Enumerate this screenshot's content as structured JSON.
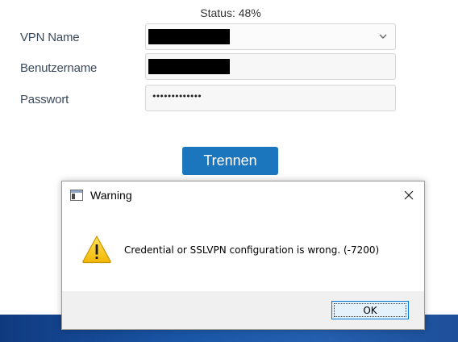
{
  "status": {
    "text": "Status: 48%",
    "progress_percent": 48
  },
  "form": {
    "vpn_name": {
      "label": "VPN Name",
      "value_redacted": true,
      "icon": "chevron-down-icon"
    },
    "username": {
      "label": "Benutzername",
      "value_redacted": true
    },
    "password": {
      "label": "Passwort",
      "masked_value": "•••••••••••••"
    },
    "disconnect_button_label": "Trennen",
    "accent_color": "#1b76bd"
  },
  "dialog": {
    "title": "Warning",
    "message": "Credential or SSLVPN configuration is wrong. (-7200)",
    "ok_label": "OK",
    "icons": {
      "app": "window-app-icon",
      "close": "close-icon",
      "warning": "warning-triangle-icon"
    },
    "warning_color": "#f6c915"
  }
}
